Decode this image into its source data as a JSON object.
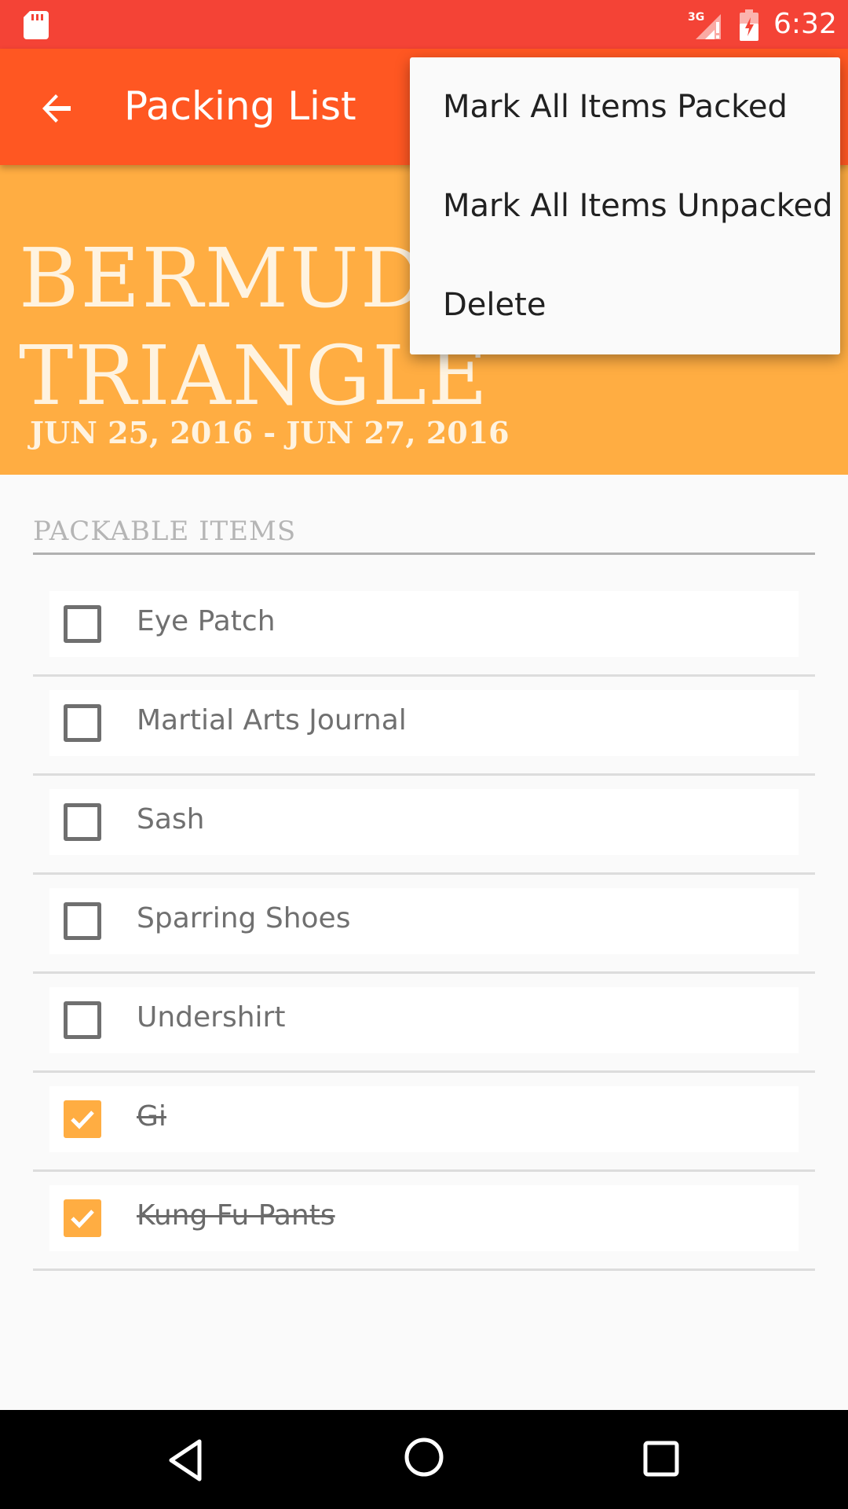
{
  "status_bar": {
    "time": "6:32",
    "network": "3G",
    "icons": [
      "sd-card-icon",
      "cell-signal-icon",
      "battery-alert-icon"
    ]
  },
  "app_bar": {
    "title": "Packing List",
    "back_icon": "arrow-back-icon"
  },
  "trip": {
    "title_line1": "BERMUDA",
    "title_line2": "TRIANGLE",
    "dates": "JUN 25, 2016 - JUN 27, 2016"
  },
  "section": {
    "label": "PACKABLE ITEMS"
  },
  "items": [
    {
      "label": "Eye Patch",
      "packed": false
    },
    {
      "label": "Martial Arts Journal",
      "packed": false
    },
    {
      "label": "Sash",
      "packed": false
    },
    {
      "label": "Sparring Shoes",
      "packed": false
    },
    {
      "label": "Undershirt",
      "packed": false
    },
    {
      "label": "Gi",
      "packed": true
    },
    {
      "label": "Kung Fu Pants",
      "packed": true
    }
  ],
  "menu": {
    "items": [
      {
        "label": "Mark All Items Packed"
      },
      {
        "label": "Mark All Items Unpacked"
      },
      {
        "label": "Delete"
      }
    ]
  },
  "nav_bar": {
    "icons": [
      "nav-back-icon",
      "nav-home-icon",
      "nav-recents-icon"
    ]
  },
  "colors": {
    "status_bar": "#f44336",
    "app_bar": "#ff5722",
    "header": "#ffad42",
    "checkbox_checked": "#ffad42"
  }
}
